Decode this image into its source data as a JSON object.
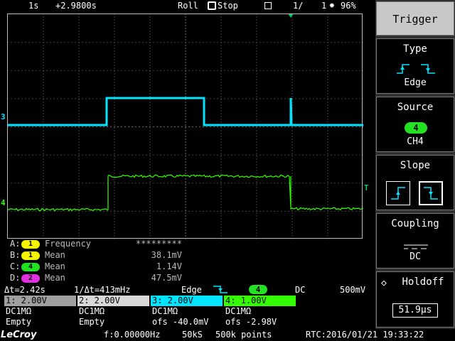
{
  "topbar": {
    "timebase": "1s",
    "delay": "+2.9800s",
    "mode": "Roll",
    "run_state": "Stop",
    "frame": "1/",
    "frame_count": "1",
    "battery": "96%"
  },
  "trace_labels": {
    "ch3": "3",
    "ch4": "4",
    "trigger": "T"
  },
  "measurements": [
    {
      "letter": "A:",
      "channel": "1",
      "color": "#f5f500",
      "name": "Frequency",
      "value": "*********"
    },
    {
      "letter": "B:",
      "channel": "1",
      "color": "#f5f500",
      "name": "Mean",
      "value": "38.1mV"
    },
    {
      "letter": "C:",
      "channel": "4",
      "color": "#22e022",
      "name": "Mean",
      "value": "1.14V"
    },
    {
      "letter": "D:",
      "channel": "2",
      "color": "#e030e0",
      "name": "Mean",
      "value": "47.5mV"
    }
  ],
  "status": {
    "delta_t": "Δt=2.42s",
    "inv_delta_t": "1/Δt=413mHz",
    "trig_type": "Edge",
    "trig_channel": "4",
    "coupling": "DC",
    "level": "500mV"
  },
  "channels": [
    {
      "head": "1: 2.00V",
      "color": "#a0a0a0",
      "line2": "DC1MΩ",
      "line3": "Empty"
    },
    {
      "head": "2: 2.00V",
      "color": "#d8d8d8",
      "line2": "DC1MΩ",
      "line3": "Empty"
    },
    {
      "head": "3: 2.00V",
      "color": "#00e5ff",
      "line2": "DC1MΩ",
      "line3": "ofs   -40.0mV"
    },
    {
      "head": "4: 1.00V",
      "color": "#33ff00",
      "line2": "DC1MΩ",
      "line3": "ofs   -2.98V"
    }
  ],
  "bottombar": {
    "brand": "LeCroy",
    "frequency": "f:0.00000Hz",
    "sample_rate": "50kS",
    "points": "500k points",
    "rtc": "RTC:2016/01/21 19:33:22"
  },
  "menu": {
    "title": "Trigger",
    "type_label": "Type",
    "type_value": "Edge",
    "source_label": "Source",
    "source_num": "4",
    "source_value": "CH4",
    "slope_label": "Slope",
    "coupling_label": "Coupling",
    "coupling_value": "DC",
    "holdoff_label": "Holdoff",
    "holdoff_value": "51.9µs"
  },
  "colors": {
    "ch3": "#00e5ff",
    "ch4": "#33ff00",
    "trigger": "#00cc66"
  }
}
